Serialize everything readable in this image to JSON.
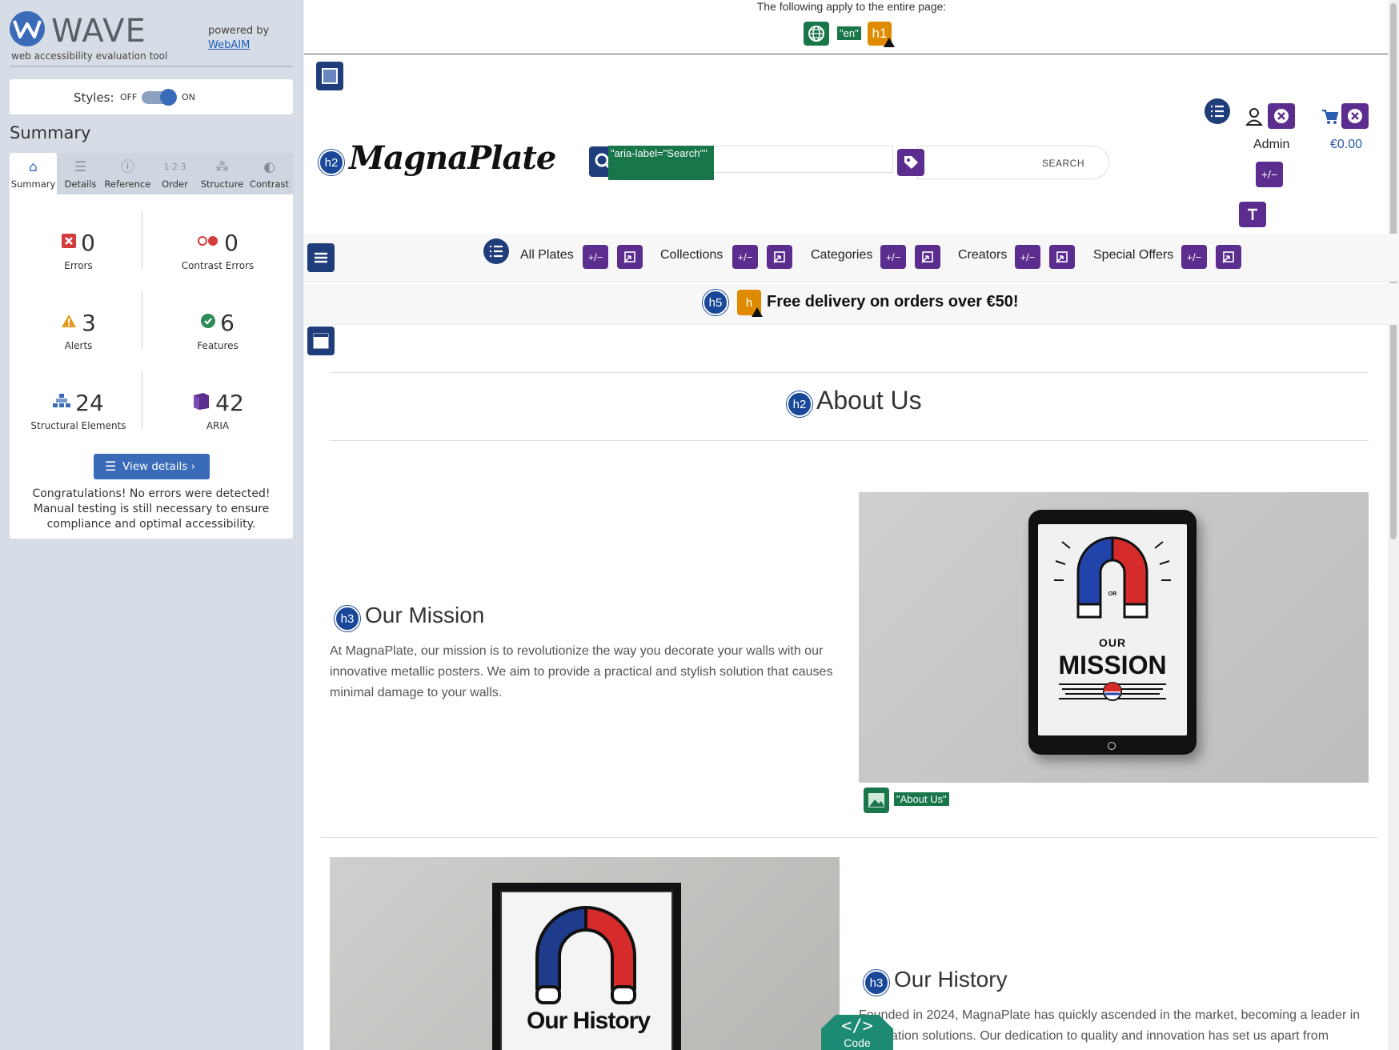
{
  "wave": {
    "title": "WAVE",
    "subtitle": "web accessibility evaluation tool",
    "powered_by": "powered by",
    "webaim_link": "WebAIM",
    "styles_label": "Styles:",
    "styles_off": "OFF",
    "styles_on": "ON",
    "styles_enabled": true,
    "summary_heading": "Summary",
    "tabs": [
      {
        "label": "Summary",
        "icon": "home-icon",
        "active": true
      },
      {
        "label": "Details",
        "icon": "list-icon",
        "active": false
      },
      {
        "label": "Reference",
        "icon": "info-icon",
        "active": false
      },
      {
        "label": "Order",
        "icon": "order-icon",
        "active": false
      },
      {
        "label": "Structure",
        "icon": "structure-icon",
        "active": false
      },
      {
        "label": "Contrast",
        "icon": "contrast-icon",
        "active": false
      }
    ],
    "stats": {
      "errors": {
        "value": "0",
        "label": "Errors",
        "color": "#d13c3c"
      },
      "contrast_errors": {
        "value": "0",
        "label": "Contrast Errors",
        "color": "#d13c3c"
      },
      "alerts": {
        "value": "3",
        "label": "Alerts",
        "color": "#e59b1d"
      },
      "features": {
        "value": "6",
        "label": "Features",
        "color": "#2e8b57"
      },
      "structural": {
        "value": "24",
        "label": "Structural Elements",
        "color": "#3a6bb8"
      },
      "aria": {
        "value": "42",
        "label": "ARIA",
        "color": "#5b2d8e"
      }
    },
    "view_details": "View details ›",
    "congrats": "Congratulations! No errors were detected! Manual testing is still necessary to ensure compliance and optimal accessibility."
  },
  "page": {
    "apply_text": "The following apply to the entire page:",
    "lang_label": "\"en\"",
    "h1_label": "h1",
    "logo": "MagnaPlate",
    "search_placeholder": "Search",
    "aria_label_text": "\"aria-label=\"Search\"\"",
    "search_button": "SEARCH",
    "admin": "Admin",
    "cart_total": "€0.00",
    "toggle_label": "+/−",
    "nav": [
      "All Plates",
      "Collections",
      "Categories",
      "Creators",
      "Special Offers"
    ],
    "h5_label": "h5",
    "promo": "Free delivery on orders over €50!",
    "h2_label": "h2",
    "h3_label": "h3",
    "about_title": "About Us",
    "mission_title": "Our Mission",
    "mission_text": "At MagnaPlate, our mission is to revolutionize the way you decorate your walls with our innovative metallic posters. We aim to provide a practical and stylish solution that causes minimal damage to your walls.",
    "mission_image_text": "OUR",
    "mission_image_word": "MISSION",
    "mission_image_or": "OR",
    "mission_alt": "\"About Us\"",
    "history_title": "Our History",
    "history_text": "Founded in 2024, MagnaPlate has quickly ascended in the market, becoming a leader in decoration solutions. Our dedication to quality and innovation has set us apart from",
    "history_image_text": "Our History",
    "code_glyph": "</>",
    "code_label": "Code"
  }
}
